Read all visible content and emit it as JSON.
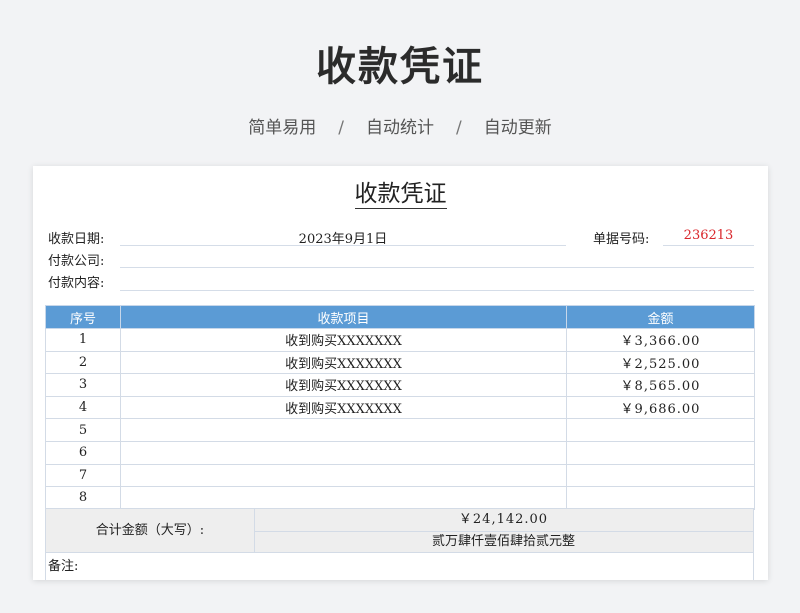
{
  "header": {
    "title": "收款凭证",
    "tags": [
      "简单易用",
      "自动统计",
      "自动更新"
    ],
    "separator": "/"
  },
  "voucher": {
    "title": "收款凭证",
    "date_label": "收款日期:",
    "date_value": "2023年9月1日",
    "doc_no_label": "单据号码:",
    "doc_no_value": "236213",
    "payer_label": "付款公司:",
    "payer_value": "",
    "content_label": "付款内容:",
    "content_value": "",
    "table": {
      "columns": [
        "序号",
        "收款项目",
        "金额"
      ],
      "rows": [
        {
          "no": "1",
          "item": "收到购买XXXXXXX",
          "amount": "￥3,366.00"
        },
        {
          "no": "2",
          "item": "收到购买XXXXXXX",
          "amount": "￥2,525.00"
        },
        {
          "no": "3",
          "item": "收到购买XXXXXXX",
          "amount": "￥8,565.00"
        },
        {
          "no": "4",
          "item": "收到购买XXXXXXX",
          "amount": "￥9,686.00"
        },
        {
          "no": "5",
          "item": "",
          "amount": ""
        },
        {
          "no": "6",
          "item": "",
          "amount": ""
        },
        {
          "no": "7",
          "item": "",
          "amount": ""
        },
        {
          "no": "8",
          "item": "",
          "amount": ""
        }
      ]
    },
    "total_label": "合计金额（大写）:",
    "total_amount": "￥24,142.00",
    "total_words": "贰万肆仟壹佰肆拾贰元整",
    "remark_label": "备注:"
  },
  "colors": {
    "header_blue": "#5b9bd5",
    "doc_no_red": "#d9262b",
    "background": "#f2f3f5"
  }
}
